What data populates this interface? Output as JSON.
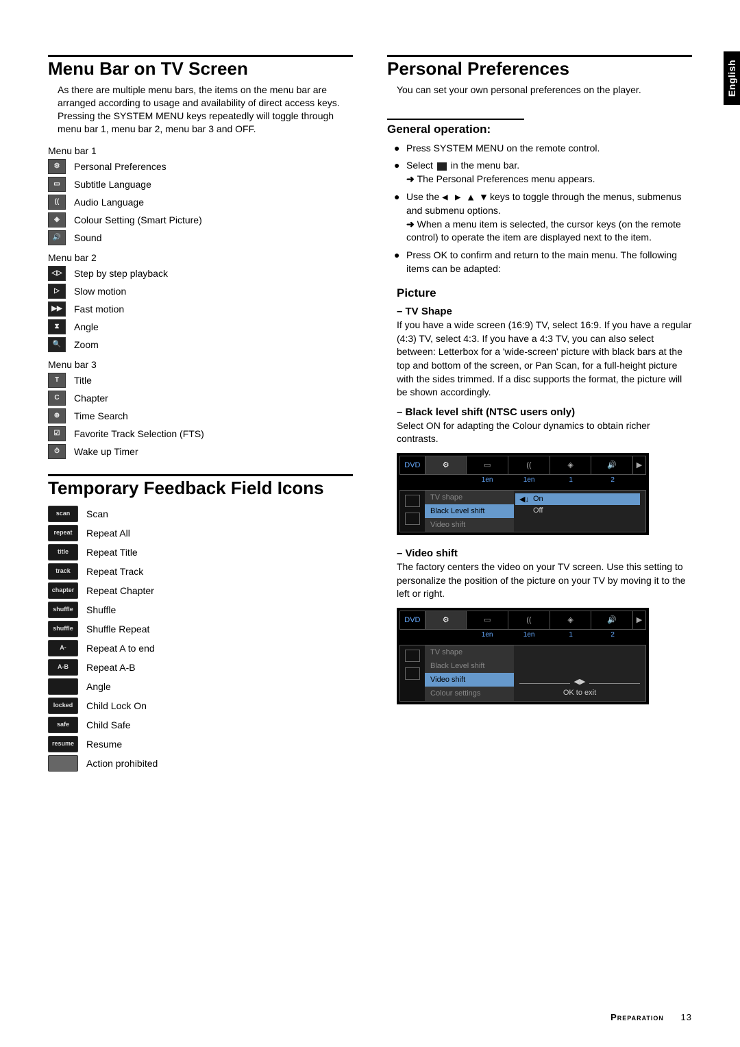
{
  "side_tab": "English",
  "footer": {
    "section": "Preparation",
    "page": "13"
  },
  "left": {
    "heading1": "Menu Bar on TV Screen",
    "intro1": "As there are multiple menu bars, the items on the menu bar are arranged according to usage and availability of direct access keys. Pressing the SYSTEM MENU keys repeatedly will toggle through menu bar 1, menu bar 2, menu bar 3 and OFF.",
    "mb1_label": "Menu bar 1",
    "mb1": [
      {
        "ico": "⚙",
        "label": "Personal Preferences"
      },
      {
        "ico": "▭",
        "label": "Subtitle Language"
      },
      {
        "ico": "((",
        "label": "Audio Language"
      },
      {
        "ico": "◈",
        "label": "Colour Setting (Smart Picture)"
      },
      {
        "ico": "🔊",
        "label": "Sound"
      }
    ],
    "mb2_label": "Menu bar 2",
    "mb2": [
      {
        "ico": "◁▷",
        "label": "Step by step playback"
      },
      {
        "ico": "▷",
        "label": "Slow motion"
      },
      {
        "ico": "▶▶",
        "label": "Fast motion"
      },
      {
        "ico": "⧗",
        "label": "Angle"
      },
      {
        "ico": "🔍",
        "label": "Zoom"
      }
    ],
    "mb3_label": "Menu bar 3",
    "mb3": [
      {
        "ico": "T",
        "label": "Title"
      },
      {
        "ico": "C",
        "label": "Chapter"
      },
      {
        "ico": "⊕",
        "label": "Time Search"
      },
      {
        "ico": "☑",
        "label": "Favorite Track Selection (FTS)"
      },
      {
        "ico": "⏱",
        "label": "Wake up Timer"
      }
    ],
    "heading2": "Temporary Feedback Field Icons",
    "feedback": [
      {
        "tag": "scan",
        "label": "Scan"
      },
      {
        "tag": "repeat",
        "label": "Repeat All"
      },
      {
        "tag": "title",
        "label": "Repeat Title"
      },
      {
        "tag": "track",
        "label": "Repeat Track"
      },
      {
        "tag": "chapter",
        "label": "Repeat Chapter"
      },
      {
        "tag": "shuffle",
        "label": "Shuffle"
      },
      {
        "tag": "shuffle",
        "label": "Shuffle Repeat"
      },
      {
        "tag": "A-",
        "label": "Repeat A to end"
      },
      {
        "tag": "A-B",
        "label": "Repeat A-B"
      },
      {
        "tag": " ",
        "label": "Angle"
      },
      {
        "tag": "locked",
        "label": "Child Lock On"
      },
      {
        "tag": "safe",
        "label": " Child Safe"
      },
      {
        "tag": "resume",
        "label": "Resume"
      },
      {
        "tag": " ",
        "label": "Action prohibited"
      }
    ]
  },
  "right": {
    "heading1": "Personal Preferences",
    "intro1": "You can set your own personal preferences on the player.",
    "genop_heading": "General operation:",
    "genop_b1": "Press SYSTEM MENU on the remote control.",
    "genop_b2a": "Select ",
    "genop_b2b": " in the menu bar.",
    "genop_b2_arrow": "The Personal Preferences menu appears.",
    "genop_b3a": "Use the ",
    "genop_b3_keys": "◀ ▶ ▲ ▼",
    "genop_b3b": " keys to toggle through the menus, submenus and submenu options.",
    "genop_b3_arrow": "When a menu item is selected, the cursor keys (on the remote control) to operate the item are displayed next to the item.",
    "genop_b4": "Press OK to confirm and return to the main menu. The following items can be adapted:",
    "picture_heading": "Picture",
    "tvshape_heading": "– TV Shape",
    "tvshape_body": "If you have a wide screen (16:9) TV, select 16:9. If you have a regular (4:3) TV, select 4:3. If you have a 4:3 TV, you can also select between: Letterbox for a 'wide-screen' picture with black bars at the top and bottom of the screen, or Pan Scan, for a full-height picture with the sides trimmed. If a disc supports the format, the picture will be shown accordingly.",
    "black_heading": "– Black level shift (NTSC users only)",
    "black_body": "Select ON for adapting the Colour dynamics to obtain richer contrasts.",
    "video_heading": "– Video shift",
    "video_body": "The factory centers the video on your TV screen. Use this setting to personalize the position of the picture on your TV by moving it to the left or right.",
    "osd1": {
      "tabs_vals": [
        "",
        "1en",
        "1en",
        "1",
        "2"
      ],
      "menu": [
        {
          "label": "TV shape",
          "sel": false
        },
        {
          "label": "Black Level shift",
          "sel": true
        },
        {
          "label": "Video shift",
          "sel": false
        }
      ],
      "vals": [
        {
          "label": "On",
          "sel": true,
          "pre": "◀↓"
        },
        {
          "label": "Off",
          "sel": false
        }
      ]
    },
    "osd2": {
      "tabs_vals": [
        "",
        "1en",
        "1en",
        "1",
        "2"
      ],
      "menu": [
        {
          "label": "TV shape",
          "sel": false
        },
        {
          "label": "Black Level shift",
          "sel": false
        },
        {
          "label": "Video shift",
          "sel": true
        },
        {
          "label": "Colour settings",
          "sel": false
        }
      ],
      "slider_hint": "◀▶",
      "ok_hint": "OK to exit"
    }
  }
}
